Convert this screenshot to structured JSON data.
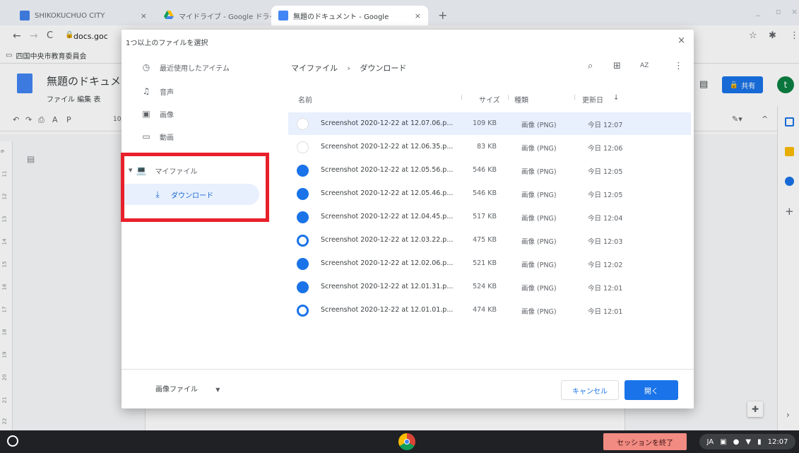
{
  "tabs": [
    {
      "label": "SHIKOKUCHUO CITY",
      "icon": "sheet-icon",
      "color": "#3c78d8"
    },
    {
      "label": "マイドライブ - Google ドライ",
      "icon": "drive-icon",
      "color": "#fbbc04"
    },
    {
      "label": "無題のドキュメント - Google",
      "icon": "docs-icon",
      "color": "#4285f4"
    }
  ],
  "new_tab": "+",
  "address": "docs.goc",
  "bookmark": "四国中央市教育委員会",
  "docs": {
    "title": "無題のドキュメ",
    "menu": "ファイル  編集  表",
    "share": "共有",
    "avatar": "t",
    "font_size": "10",
    "ruler": [
      "9",
      "11",
      "12",
      "13",
      "14",
      "15",
      "16",
      "17",
      "18",
      "19",
      "20",
      "21",
      "22"
    ]
  },
  "dialog": {
    "title": "1つ以上のファイルを選択",
    "close": "×",
    "nav": [
      {
        "label": "最近使用したアイテム",
        "icon": "clock-icon"
      },
      {
        "label": "音声",
        "icon": "headphones-icon"
      },
      {
        "label": "画像",
        "icon": "image-icon"
      },
      {
        "label": "動画",
        "icon": "video-icon"
      },
      {
        "label": "マイファイル",
        "icon": "laptop-icon"
      },
      {
        "label": "ダウンロード",
        "icon": "download-icon"
      }
    ],
    "breadcrumb": [
      "マイファイル",
      "ダウンロード"
    ],
    "headers": {
      "name": "名前",
      "size": "サイズ",
      "type": "種類",
      "modified": "更新日"
    },
    "sort_az": "AZ",
    "files": [
      {
        "name": "Screenshot 2020-12-22 at 12.07.06.p...",
        "size": "109 KB",
        "type": "画像 (PNG)",
        "date": "今日 12:07"
      },
      {
        "name": "Screenshot 2020-12-22 at 12.06.35.p...",
        "size": "83 KB",
        "type": "画像 (PNG)",
        "date": "今日 12:06"
      },
      {
        "name": "Screenshot 2020-12-22 at 12.05.56.p...",
        "size": "546 KB",
        "type": "画像 (PNG)",
        "date": "今日 12:05"
      },
      {
        "name": "Screenshot 2020-12-22 at 12.05.46.p...",
        "size": "546 KB",
        "type": "画像 (PNG)",
        "date": "今日 12:05"
      },
      {
        "name": "Screenshot 2020-12-22 at 12.04.45.p...",
        "size": "517 KB",
        "type": "画像 (PNG)",
        "date": "今日 12:04"
      },
      {
        "name": "Screenshot 2020-12-22 at 12.03.22.p...",
        "size": "475 KB",
        "type": "画像 (PNG)",
        "date": "今日 12:03"
      },
      {
        "name": "Screenshot 2020-12-22 at 12.02.06.p...",
        "size": "521 KB",
        "type": "画像 (PNG)",
        "date": "今日 12:02"
      },
      {
        "name": "Screenshot 2020-12-22 at 12.01.31.p...",
        "size": "524 KB",
        "type": "画像 (PNG)",
        "date": "今日 12:01"
      },
      {
        "name": "Screenshot 2020-12-22 at 12.01.01.p...",
        "size": "474 KB",
        "type": "画像 (PNG)",
        "date": "今日 12:01"
      }
    ],
    "file_type": "画像ファイル",
    "cancel": "キャンセル",
    "open": "開く"
  },
  "shelf": {
    "end_session": "セッションを終了",
    "ime": "JA",
    "time": "12:07"
  },
  "colors": {
    "accent": "#1a73e8",
    "highlight": "#e8202a",
    "end_session": "#f28b82"
  }
}
